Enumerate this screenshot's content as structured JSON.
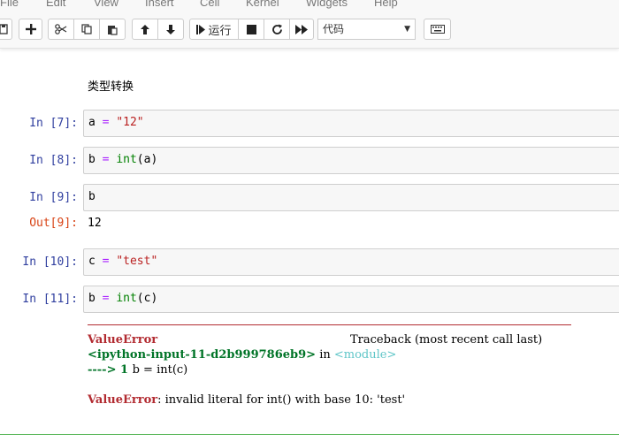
{
  "menu": [
    "File",
    "Edit",
    "View",
    "Insert",
    "Cell",
    "Kernel",
    "Widgets",
    "Help"
  ],
  "toolbar": {
    "run_label": "运行",
    "cell_type": "代码"
  },
  "markdown": "类型转换",
  "cells": [
    {
      "prompt": "In  [7]:",
      "code": {
        "var": "a",
        "op": "=",
        "value": "\"12\""
      }
    },
    {
      "prompt": "In  [8]:",
      "code": {
        "var": "b",
        "op": "=",
        "func": "int",
        "arg": "(a)"
      }
    },
    {
      "prompt": "In  [9]:",
      "code": {
        "var": "b"
      }
    },
    {
      "prompt": "In  [10]:",
      "code": {
        "var": "c",
        "op": "=",
        "value": "\"test\""
      }
    },
    {
      "prompt": "In  [11]:",
      "code": {
        "var": "b",
        "op": "=",
        "func": "int",
        "arg": "(c)"
      }
    }
  ],
  "output": {
    "prompt": "Out[9]:",
    "value": "12"
  },
  "traceback": {
    "error_name": "ValueError",
    "header_right": "Traceback (most recent call last)",
    "source": "<ipython-input-11-d2b999786eb9>",
    "in_word": " in ",
    "module": "<module>",
    "arrow": "---->",
    "line_no": " 1 ",
    "line_code": "b = int(c)",
    "message": ": invalid literal for int() with base 10: 'test'"
  }
}
